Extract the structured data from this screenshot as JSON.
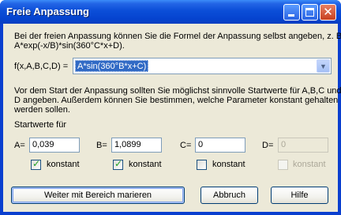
{
  "window": {
    "title": "Freie Anpassung"
  },
  "intro": {
    "line1": "Bei der freien Anpassung können Sie die Formel der Anpassung selbst angeben, z. B.",
    "line2": "A*exp(-x/B)*sin(360°C*x+D)."
  },
  "formula": {
    "label": "f(x,A,B,C,D) =",
    "value": "A*sin(360°B*x+C)"
  },
  "info": {
    "line1": "Vor dem Start der Anpassung sollten Sie möglichst sinnvolle Startwerte für A,B,C und",
    "line2": "D angeben. Außerdem können Sie bestimmen, welche Parameter konstant gehalten",
    "line3": "werden sollen."
  },
  "start_label": "Startwerte für",
  "params": [
    {
      "label": "A=",
      "value": "0,039",
      "enabled": true,
      "constant": true,
      "constant_label": "konstant"
    },
    {
      "label": "B=",
      "value": "1,0899",
      "enabled": true,
      "constant": true,
      "constant_label": "konstant"
    },
    {
      "label": "C=",
      "value": "0",
      "enabled": true,
      "constant": false,
      "constant_label": "konstant"
    },
    {
      "label": "D=",
      "value": "0",
      "enabled": false,
      "constant": false,
      "constant_label": "konstant"
    }
  ],
  "buttons": {
    "continue": "Weiter mit Bereich marieren",
    "cancel": "Abbruch",
    "help": "Hilfe"
  }
}
